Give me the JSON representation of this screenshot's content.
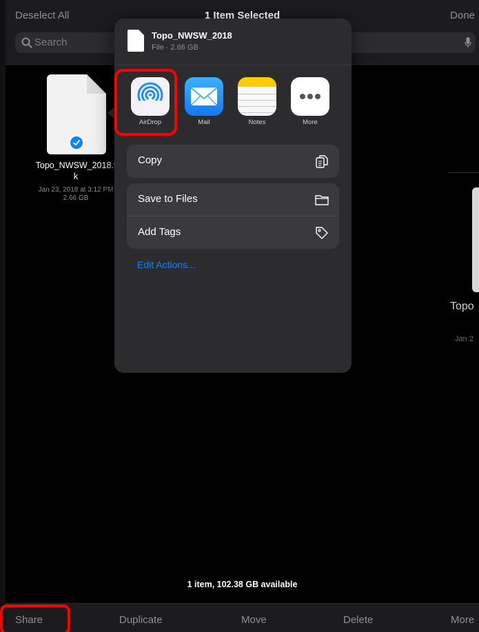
{
  "nav": {
    "deselect_label": "Deselect All",
    "title": "1 Item Selected",
    "done_label": "Done"
  },
  "search": {
    "placeholder": "Search"
  },
  "file": {
    "name": "Topo_NWSW_2018.t k",
    "name_line1": "Topo_NWSW_2018.t",
    "name_line2": "k",
    "date": "Jan 23, 2018 at 3:12 PM",
    "size": "2.66 GB"
  },
  "right_tile": {
    "name": "Topo",
    "date": "Jan 2"
  },
  "share_sheet": {
    "title": "Topo_NWSW_2018",
    "subtitle": "File · 2.66 GB",
    "apps": [
      {
        "label": "AirDrop",
        "icon": "airdrop-icon"
      },
      {
        "label": "Mail",
        "icon": "mail-icon"
      },
      {
        "label": "Notes",
        "icon": "notes-icon"
      },
      {
        "label": "More",
        "icon": "more-icon"
      }
    ],
    "actions": {
      "copy": {
        "label": "Copy",
        "icon": "copy-icon"
      },
      "save_to_files": {
        "label": "Save to Files",
        "icon": "folder-icon"
      },
      "add_tags": {
        "label": "Add Tags",
        "icon": "tag-icon"
      }
    },
    "edit_actions_label": "Edit Actions..."
  },
  "footer": {
    "status": "1 item, 102.38 GB available",
    "toolbar": {
      "share": "Share",
      "duplicate": "Duplicate",
      "move": "Move",
      "delete": "Delete",
      "more": "More"
    }
  },
  "colors": {
    "accent": "#0a84ff",
    "annotation": "#ff0000",
    "sheet_bg": "#2c2c2e"
  }
}
